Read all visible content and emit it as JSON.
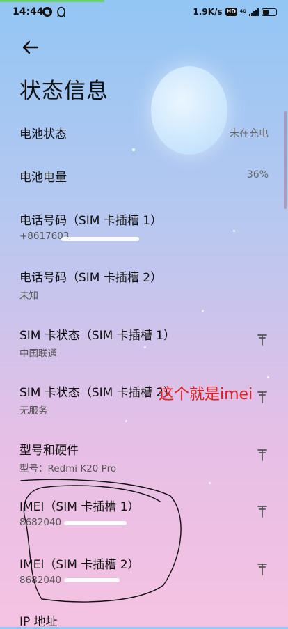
{
  "status_bar": {
    "time": "14:44",
    "network_speed": "1.9K/s",
    "hd_badge": "HD",
    "network_type": "4G"
  },
  "page": {
    "title": "状态信息"
  },
  "rows": [
    {
      "label": "电池状态",
      "value": "未在充电"
    },
    {
      "label": "电池电量",
      "value": "36%"
    },
    {
      "label": "电话号码（SIM 卡插槽 1）",
      "sub": "+8617603"
    },
    {
      "label": "电话号码（SIM 卡插槽 2）",
      "sub": "未知"
    },
    {
      "label": "SIM 卡状态（SIM 卡插槽 1）",
      "sub": "中国联通"
    },
    {
      "label": "SIM 卡状态（SIM 卡插槽 2）",
      "sub": "无服务"
    },
    {
      "label": "型号和硬件",
      "sub": "型号：Redmi K20 Pro"
    },
    {
      "label": "IMEI（SIM 卡插槽 1）",
      "sub": "8682040"
    },
    {
      "label": "IMEI（SIM 卡插槽 2）",
      "sub": "8682040"
    },
    {
      "label": "IP 地址"
    }
  ],
  "annotation": {
    "text": "这个就是imei",
    "color": "#e0201f"
  },
  "colors": {
    "bg_top": "#93c6f4",
    "bg_bottom": "#f5c2e2"
  },
  "icons": [
    "back-arrow-icon",
    "pin-icon"
  ]
}
